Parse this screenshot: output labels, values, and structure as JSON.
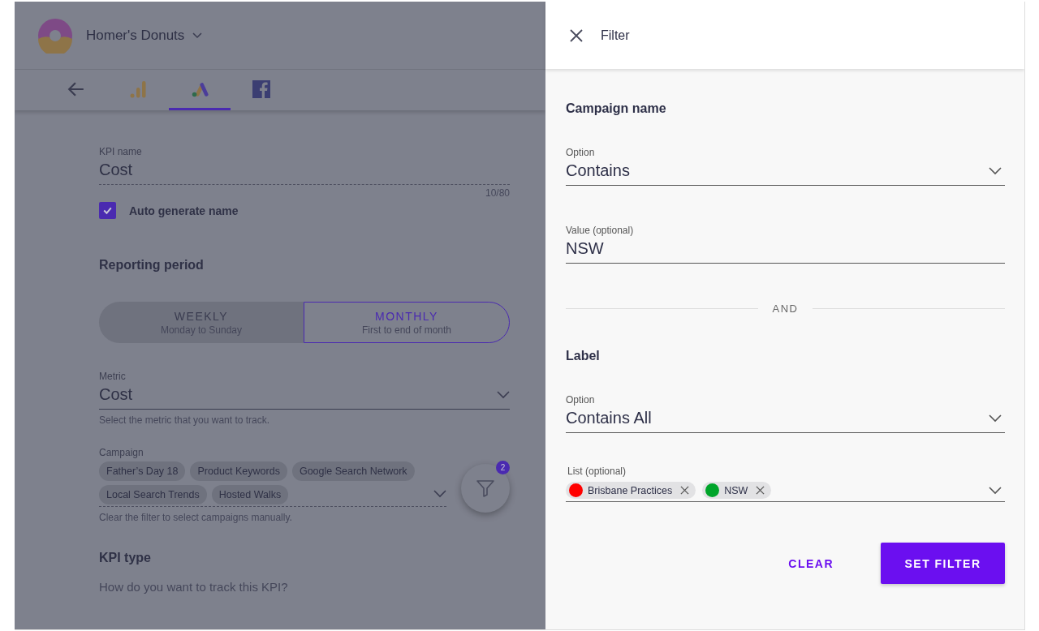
{
  "app": {
    "account": "Homer's Donuts",
    "tabs": [
      {
        "kind": "back",
        "selected": false
      },
      {
        "kind": "analytics",
        "selected": false
      },
      {
        "kind": "ads",
        "selected": true
      },
      {
        "kind": "facebook",
        "selected": false
      }
    ],
    "kpi_name": {
      "label": "KPI name",
      "value": "Cost",
      "counter": "10/80"
    },
    "auto_generate": {
      "label": "Auto generate name",
      "checked": true
    },
    "reporting_period": {
      "title": "Reporting period",
      "options": [
        {
          "label": "WEEKLY",
          "sub": "Monday to Sunday",
          "selected": false
        },
        {
          "label": "MONTHLY",
          "sub": "First to end of month",
          "selected": true
        }
      ]
    },
    "metric": {
      "label": "Metric",
      "value": "Cost",
      "hint": "Select the metric that you want to track."
    },
    "campaign": {
      "label": "Campaign",
      "chips": [
        "Father’s Day 18",
        "Product Keywords",
        "Google Search Network",
        "Local Search Trends",
        "Hosted Walks"
      ],
      "hint": "Clear the filter to select campaigns manually."
    },
    "filter_fab": {
      "badge": "2"
    },
    "kpi_type": {
      "title": "KPI type",
      "question": "How do you want to track this KPI?"
    }
  },
  "filter_panel": {
    "title": "Filter",
    "campaign_name": {
      "title": "Campaign name",
      "option": {
        "label": "Option",
        "value": "Contains"
      },
      "value": {
        "label": "Value (optional)",
        "value": "NSW"
      }
    },
    "joiner": "AND",
    "label": {
      "title": "Label",
      "option": {
        "label": "Option",
        "value": "Contains All"
      },
      "list": {
        "label": "List (optional)",
        "chips": [
          {
            "text": "Brisbane Practices",
            "color": "#ff0000"
          },
          {
            "text": "NSW",
            "color": "#00a52a"
          }
        ]
      }
    },
    "buttons": {
      "clear": "CLEAR",
      "set": "SET FILTER"
    }
  }
}
